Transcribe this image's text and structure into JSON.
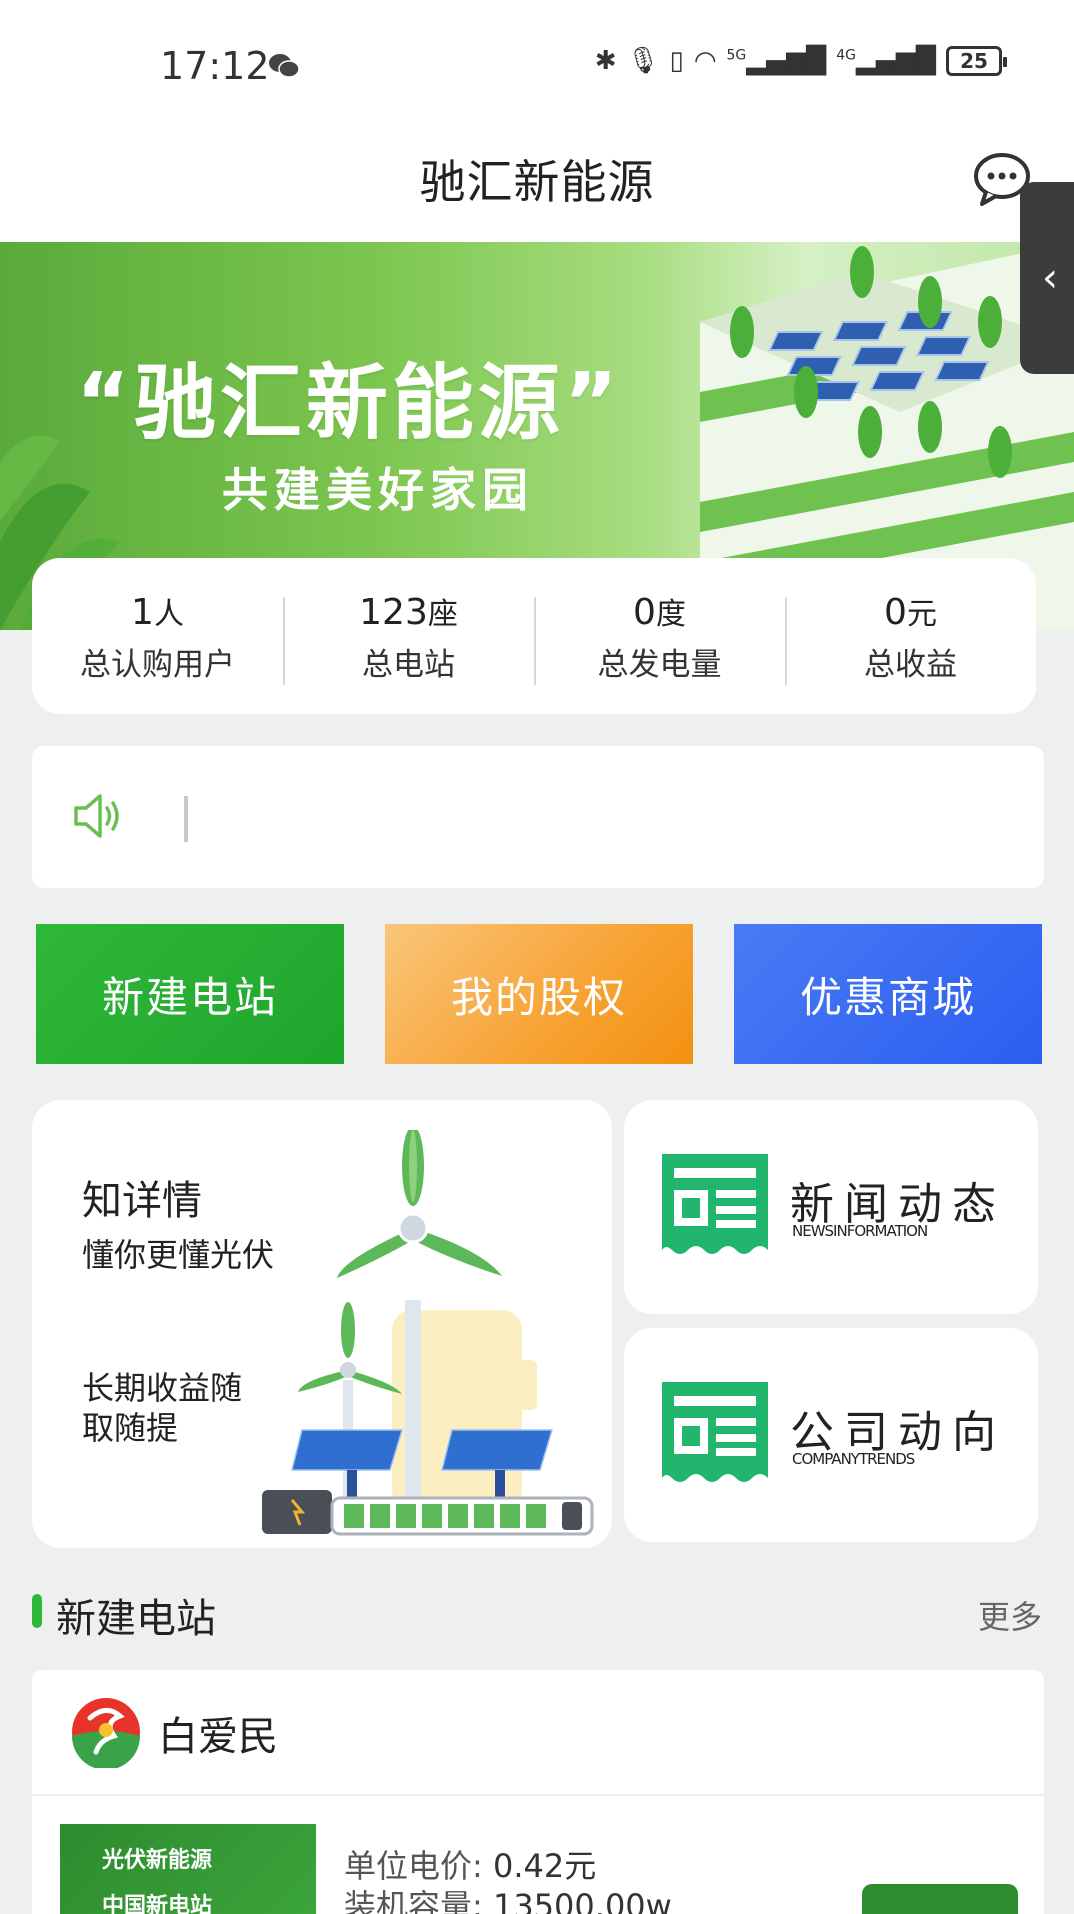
{
  "status_bar": {
    "time": "17:12",
    "network_5g": "5G",
    "network_4g": "4G",
    "battery": "25"
  },
  "header": {
    "title": "驰汇新能源"
  },
  "banner": {
    "title": "“驰汇新能源”",
    "subtitle": "共建美好家园"
  },
  "stats": [
    {
      "value": "1",
      "unit": "人",
      "label": "总认购用户"
    },
    {
      "value": "123",
      "unit": "座",
      "label": "总电站"
    },
    {
      "value": "0",
      "unit": "度",
      "label": "总发电量"
    },
    {
      "value": "0",
      "unit": "元",
      "label": "总收益"
    }
  ],
  "actions": {
    "new_station": "新建电站",
    "my_equity": "我的股权",
    "mall": "优惠商城"
  },
  "feature": {
    "title": "知详情",
    "subtitle": "懂你更懂光伏",
    "desc": "长期收益随取随提"
  },
  "news": {
    "title": "新闻动态",
    "subtitle_en": "NEWSINFORMATION"
  },
  "company": {
    "title": "公司动向",
    "subtitle_en": "COMPANYTRENDS"
  },
  "section": {
    "title": "新建电站",
    "more": "更多"
  },
  "station": {
    "owner": "白爱民",
    "thumb_line1": "光伏新能源",
    "thumb_line2": "中国新电站",
    "price_label": "单位电价:",
    "price_value": "0.42元",
    "capacity_label": "装机容量:",
    "capacity_value": "13500.00w"
  },
  "colors": {
    "primary_green": "#2fb73a",
    "orange": "#f7a233",
    "blue": "#2a5ef0"
  }
}
